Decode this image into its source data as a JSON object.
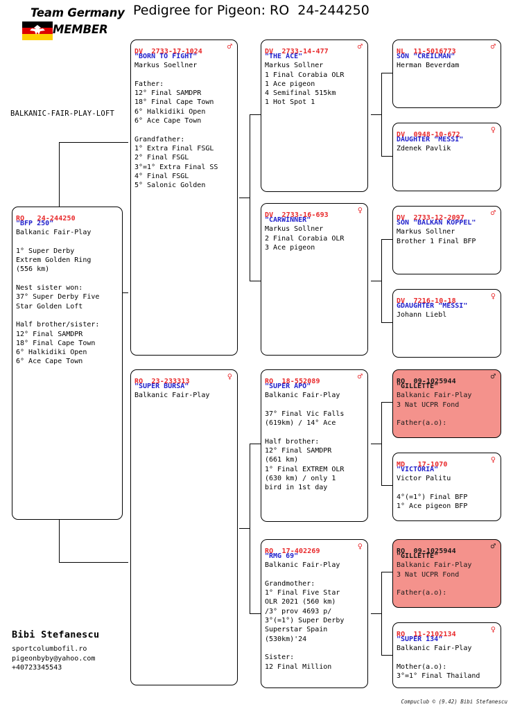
{
  "header": {
    "title": "Pedigree for Pigeon: RO  24-244250",
    "logo": {
      "line1": "Team Germany",
      "line2": "MEMBER",
      "flag_colors": [
        "#000000",
        "#dd0000",
        "#ffce00"
      ]
    }
  },
  "loft_name": "BALKANIC-FAIR-PLAY-LOFT",
  "breeder": {
    "name": "Bibi Stefanescu",
    "website": "sportcolumbofil.ro",
    "email": "pigeonbyby@yahoo.com",
    "phone": "+40723345543"
  },
  "footer": {
    "credit": "Compuclub © (9.42)  Bibi Stefanescu"
  },
  "colors": {
    "ring": "#e8282a",
    "name": "#2222cc",
    "text": "#000000",
    "highlight_bg": "#f4928c",
    "border": "#000000"
  },
  "symbols": {
    "male": "♂",
    "female": "♀"
  },
  "pedigree": {
    "subject": {
      "ring": "RO   24-244250",
      "name": "\"BFP 250\"",
      "sex": "",
      "body": "Balkanic Fair-Play\n\n1° Super Derby\nExtrem Golden Ring\n(556 km)\n\nNest sister won:\n37° Super Derby Five\nStar Golden Loft\n\nHalf brother/sister:\n12° Final SAMDPR\n18° Final Cape Town\n6° Halkidiki Open\n6° Ace Cape Town",
      "highlight": false
    },
    "generation1": [
      {
        "ring": "DV  2733-17-1024",
        "name": "\"BORN TO FIGHT\"",
        "sex": "male",
        "body": "Markus Soellner\n\nFather:\n12° Final SAMDPR\n18° Final Cape Town\n6° Halkidiki Open\n6° Ace Cape Town\n\nGrandfather:\n1° Extra Final FSGL\n2° Final FSGL\n3°=1° Extra Final SS\n4° Final FSGL\n5° Salonic Golden",
        "highlight": false
      },
      {
        "ring": "RO  23-233313",
        "name": "\"SUPER BURSA\"",
        "sex": "female",
        "body": "Balkanic Fair-Play",
        "highlight": false
      }
    ],
    "generation2": [
      {
        "ring": "DV  2733-14-477",
        "name": "\"THE ACE\"",
        "sex": "male",
        "body": "Markus Sollner\n1 Final Corabia OLR\n1 Ace pigeon\n4 Semifinal 515km\n1 Hot Spot 1",
        "highlight": false
      },
      {
        "ring": "DV  2733-16-693",
        "name": "\"CARWINNER\"",
        "sex": "female",
        "body": "Markus Sollner\n2 Final Corabia OLR\n3 Ace pigeon",
        "highlight": false
      },
      {
        "ring": "RO  18-552089",
        "name": "\"SUPER APO\"",
        "sex": "male",
        "body": "Balkanic Fair-Play\n\n37° Final Vic Falls\n(619km) / 14° Ace\n\nHalf brother:\n12° Final SAMDPR\n(661 km)\n1° Final EXTREM OLR\n(630 km) / only 1\nbird in 1st day",
        "highlight": false
      },
      {
        "ring": "RO  17-402269",
        "name": "\"RMG 69\"",
        "sex": "female",
        "body": "Balkanic Fair-Play\n\nGrandmother:\n1° Final Five Star\nOLR 2021 (560 km)\n/3° prov 4693 p/\n3°(=1°) Super Derby\nSuperstar Spain\n(530km)'24\n\nSister:\n12 Final Million",
        "highlight": false
      }
    ],
    "generation3": [
      {
        "ring": "NL  11-5016773",
        "name": "SON \"CREILMAN\"",
        "sex": "male",
        "body": "Herman Beverdam",
        "highlight": false
      },
      {
        "ring": "DV  0948-10-672",
        "name": "DAUGHTER \"MESSI\"",
        "sex": "female",
        "body": "Zdenek Pavlik",
        "highlight": false
      },
      {
        "ring": "DV  2733-12-2097",
        "name": "SON \"BALKAN KOPPEL\"",
        "sex": "male",
        "body": "Markus Sollner\nBrother 1 Final BFP",
        "highlight": false
      },
      {
        "ring": "DV  7216-10-18",
        "name": "GDAUGHTER \"MESSI\"",
        "sex": "female",
        "body": "Johann Liebl",
        "highlight": false
      },
      {
        "ring": "RO  09-1025944",
        "name": "\"GILLETTE\"",
        "sex": "male",
        "body": "Balkanic Fair-Play\n3 Nat UCPR Fond\n\nFather(a.o):",
        "highlight": true
      },
      {
        "ring": "MD   17-1070",
        "name": "\"VICTORIA\"",
        "sex": "female",
        "body": "Victor Palitu\n\n4°(=1°) Final BFP\n1° Ace pigeon BFP",
        "highlight": false
      },
      {
        "ring": "RO  09-1025944",
        "name": "\"GILLETTE\"",
        "sex": "male",
        "body": "Balkanic Fair-Play\n3 Nat UCPR Fond\n\nFather(a.o):",
        "highlight": true
      },
      {
        "ring": "RO  11-2102134",
        "name": "\"SUPER 134\"",
        "sex": "female",
        "body": "Balkanic Fair-Play\n\nMother(a.o):\n3°=1° Final Thailand",
        "highlight": false
      }
    ]
  }
}
